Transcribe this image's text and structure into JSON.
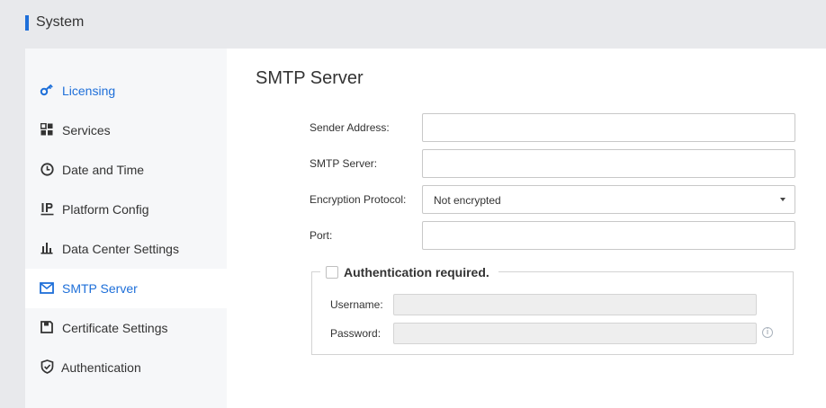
{
  "header": {
    "title": "System",
    "accent_color": "#1e6fd9"
  },
  "sidebar": {
    "items": [
      {
        "label": "Licensing",
        "icon": "key-icon",
        "name": "sidebar-item-licensing"
      },
      {
        "label": "Services",
        "icon": "grid-icon",
        "name": "sidebar-item-services"
      },
      {
        "label": "Date and Time",
        "icon": "clock-icon",
        "name": "sidebar-item-date-and-time"
      },
      {
        "label": "Platform Config",
        "icon": "ip-icon",
        "name": "sidebar-item-platform-config"
      },
      {
        "label": "Data Center Settings",
        "icon": "bar-chart-icon",
        "name": "sidebar-item-data-center-settings"
      },
      {
        "label": "SMTP Server",
        "icon": "mail-icon",
        "name": "sidebar-item-smtp-server",
        "active": true
      },
      {
        "label": "Certificate Settings",
        "icon": "save-icon",
        "name": "sidebar-item-certificate-settings"
      },
      {
        "label": "Authentication",
        "icon": "shield-icon",
        "name": "sidebar-item-authentication"
      }
    ]
  },
  "main": {
    "title": "SMTP Server",
    "form": {
      "sender_address": {
        "label": "Sender Address:",
        "value": ""
      },
      "smtp_server": {
        "label": "SMTP Server:",
        "value": ""
      },
      "encryption_protocol": {
        "label": "Encryption Protocol:",
        "value": "Not encrypted"
      },
      "port": {
        "label": "Port:",
        "value": ""
      }
    },
    "auth": {
      "label": "Authentication required.",
      "checked": false,
      "username": {
        "label": "Username:",
        "value": ""
      },
      "password": {
        "label": "Password:",
        "value": ""
      },
      "info_icon": "info-icon"
    }
  },
  "colors": {
    "accent": "#1e6fd9",
    "sidebar_bg": "#f6f7f9",
    "page_bg": "#e8e9ec"
  }
}
